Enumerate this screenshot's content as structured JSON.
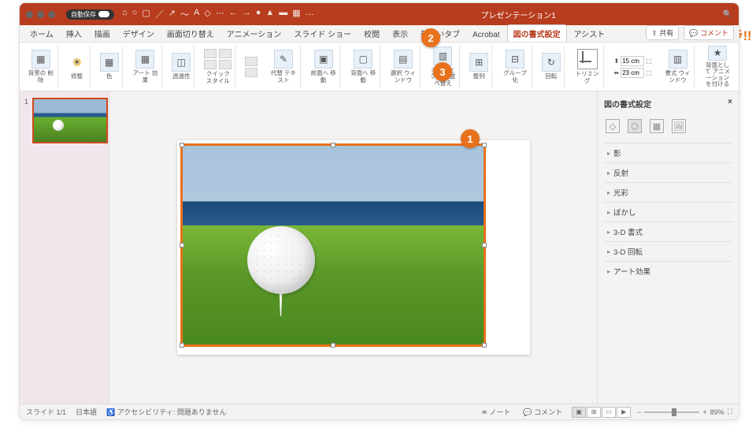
{
  "title": "プレゼンテーション1",
  "autosave": "自動保存",
  "tabs": [
    "ホーム",
    "挿入",
    "描画",
    "デザイン",
    "画面切り替え",
    "アニメーション",
    "スライド ショー",
    "校閲",
    "表示",
    "新しいタブ",
    "Acrobat",
    "図の書式設定"
  ],
  "tabs_extra": "アシスト",
  "share": "共有",
  "comment": "コメント",
  "ribbon": {
    "bg_remove": "背景の\n削除",
    "adjust": "修整",
    "color": "色",
    "art": "アート\n効果",
    "transparency": "透過性",
    "quick": "クイック\nスタイル",
    "alt": "代替\nテキスト",
    "forward": "前面へ\n移動",
    "backward": "背面へ\n移動",
    "select": "選択\nウィンドウ",
    "objects": "オブジェクト\nの並べ替え",
    "align": "整列",
    "group": "グループ\n化",
    "rotate": "回転",
    "crop": "トリミング",
    "h": "15 cm",
    "w": "23 cm",
    "style_win": "書式\nウィンドウ",
    "anim": "背面として\nアニメーションを付ける"
  },
  "panel": {
    "title": "図の書式設定",
    "items": [
      "影",
      "反射",
      "光彩",
      "ぼかし",
      "3-D 書式",
      "3-D 回転",
      "アート効果"
    ]
  },
  "status": {
    "slide": "スライド 1/1",
    "lang": "日本語",
    "a11y": "アクセシビリティ: 問題ありません",
    "notes": "ノート",
    "comments": "コメント",
    "zoom": "89%"
  },
  "callouts": {
    "c1": "1",
    "c2": "2",
    "c3": "3"
  },
  "brand": "シースラ!!"
}
